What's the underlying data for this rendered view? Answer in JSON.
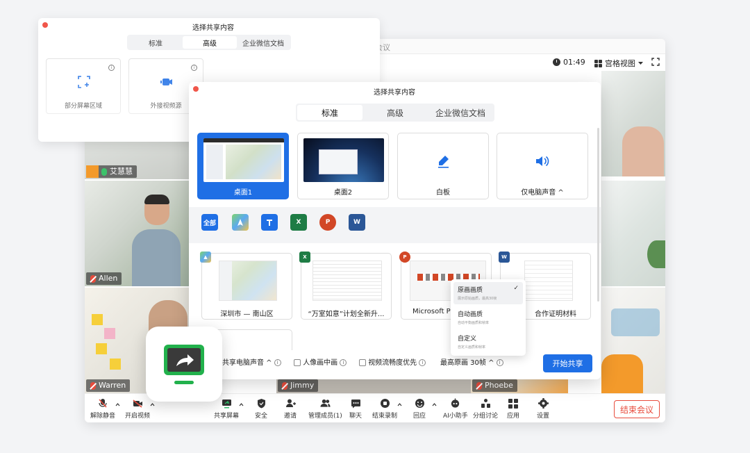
{
  "meeting": {
    "title": "会议",
    "timer": "01:49",
    "view_mode": "宫格视图",
    "participants": [
      {
        "name": "艾慧慧",
        "mic": "on"
      },
      {
        "name": "Allen",
        "mic": "off"
      },
      {
        "name": "Warren",
        "mic": "off"
      },
      {
        "name": "Jimmy",
        "mic": "off"
      },
      {
        "name": "Phoebe",
        "mic": "off"
      }
    ],
    "toolbar": {
      "unmute": "解除静音",
      "start_video": "开启视频",
      "share_screen": "共享屏幕",
      "security": "安全",
      "invite": "邀请",
      "manage_members": "管理成员(1)",
      "chat": "聊天",
      "end_recording": "结束录制",
      "reactions": "回应",
      "ai_assistant": "AI小助手",
      "breakout": "分组讨论",
      "apps": "应用",
      "settings": "设置",
      "end_meeting": "结束会议"
    }
  },
  "share_dialog_back": {
    "title": "选择共享内容",
    "tabs": [
      {
        "label": "标准",
        "active": false
      },
      {
        "label": "高级",
        "active": true
      },
      {
        "label": "企业微信文档",
        "active": false
      }
    ],
    "cards": [
      {
        "label": "部分屏幕区域",
        "icon": "crop-area-icon"
      },
      {
        "label": "外接视频源",
        "icon": "camera-icon"
      }
    ]
  },
  "share_dialog": {
    "title": "选择共享内容",
    "tabs": [
      {
        "label": "标准",
        "active": true
      },
      {
        "label": "高级",
        "active": false
      },
      {
        "label": "企业微信文档",
        "active": false
      }
    ],
    "screens": [
      {
        "label": "桌面1",
        "selected": true
      },
      {
        "label": "桌面2",
        "selected": false
      },
      {
        "label": "白板",
        "selected": false,
        "icon": "pencil-icon"
      },
      {
        "label": "仅电脑声音 ^",
        "selected": false,
        "icon": "speaker-icon"
      }
    ],
    "filters": [
      {
        "label": "全部",
        "active": true
      },
      {
        "icon": "maps-icon"
      },
      {
        "icon": "tencent-meeting-icon"
      },
      {
        "icon": "excel-icon"
      },
      {
        "icon": "powerpoint-icon"
      },
      {
        "icon": "word-icon"
      }
    ],
    "windows": [
      {
        "label": "深圳市 — 南山区",
        "app": "maps"
      },
      {
        "label": "“万室如意”计划全新升...",
        "app": "excel"
      },
      {
        "label": "Microsoft Po",
        "app": "powerpoint"
      },
      {
        "label": "合作证明材料",
        "app": "word"
      }
    ],
    "options": {
      "share_audio": "共享电脑声音 ^",
      "portrait_pip": "人像画中画",
      "video_smooth": "视频流畅度优先",
      "max_quality": "最高原画 30帧 ^"
    },
    "start_button": "开始共享",
    "quality_menu": [
      {
        "title": "原画画质",
        "desc": "展示原始画质，最高30帧",
        "checked": true
      },
      {
        "title": "自动画质",
        "desc": "自动平衡画质和帧率",
        "checked": false
      },
      {
        "title": "自定义",
        "desc": "自定义画质和帧率",
        "checked": false
      }
    ]
  },
  "colors": {
    "accent": "#1f6fe5",
    "danger": "#e84b3c",
    "app_green": "#22b14c"
  }
}
